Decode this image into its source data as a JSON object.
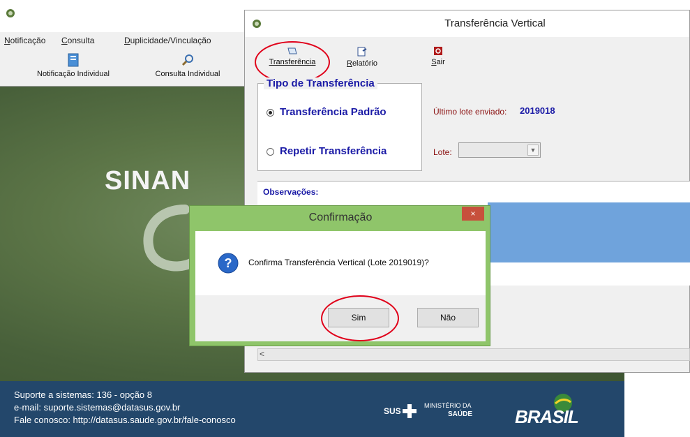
{
  "main_window": {
    "menu": [
      {
        "underline": "N",
        "rest": "otificação"
      },
      {
        "underline": "C",
        "rest": "onsulta"
      },
      {
        "underline": "D",
        "rest": "uplicidade/Vinculação"
      }
    ],
    "toolbar": {
      "notificacao_label": "Notificação Individual",
      "consulta_label": "Consulta Individual"
    },
    "logo_text": "SINAN",
    "footer": {
      "line1": "Suporte a sistemas: 136 - opção 8",
      "line2": "e-mail: suporte.sistemas@datasus.gov.br",
      "line3": "Fale conosco: http://datasus.saude.gov.br/fale-conosco",
      "sus": "SUS",
      "ministerio": "MINISTÉRIO DA",
      "saude": "SAÚDE",
      "brasil": "BRASIL"
    }
  },
  "tv_window": {
    "title": "Transferência Vertical",
    "toolbar": {
      "transferencia": "Transferência",
      "relatorio_u": "R",
      "relatorio_rest": "elatório",
      "sair_u": "S",
      "sair_rest": "air"
    },
    "tipo": {
      "legend": "Tipo de Transferência",
      "option1": "Transferência Padrão",
      "option2": "Repetir Transferência"
    },
    "ultimo_label": "Último lote enviado:",
    "ultimo_value": "2019018",
    "lote_label": "Lote:",
    "lote_value": "",
    "observacoes_label": "Observações:"
  },
  "confirm_dialog": {
    "title": "Confirmação",
    "close": "×",
    "message": "Confirma Transferência Vertical (Lote 2019019)?",
    "yes": "Sim",
    "no": "Não"
  },
  "colors": {
    "highlight": "#e0001a",
    "dialog_frame": "#8fc56a",
    "footer": "#23476b",
    "label_blue": "#1a1aa6"
  }
}
